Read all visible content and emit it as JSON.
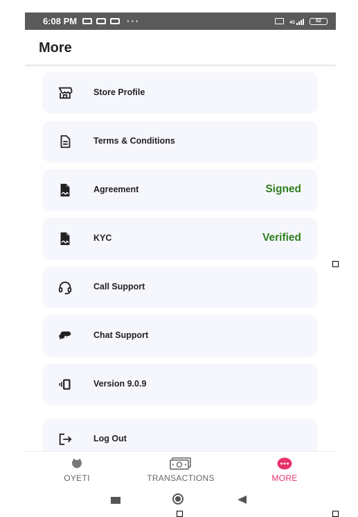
{
  "status_bar": {
    "time": "6:08 PM",
    "dots": "···",
    "volte": "4G",
    "battery": "62"
  },
  "header": {
    "title": "More"
  },
  "menu": {
    "items": [
      {
        "label": "Store Profile",
        "icon": "store-icon"
      },
      {
        "label": "Terms & Conditions",
        "icon": "document-icon"
      },
      {
        "label": "Agreement",
        "icon": "signature-file-icon",
        "status": "Signed"
      },
      {
        "label": "KYC",
        "icon": "signature-file-icon",
        "status": "Verified"
      },
      {
        "label": "Call Support",
        "icon": "headset-icon"
      },
      {
        "label": "Chat Support",
        "icon": "chat-bubbles-icon"
      },
      {
        "label": "Version 9.0.9",
        "icon": "phone-vibrate-icon"
      },
      {
        "label": "Log Out",
        "icon": "logout-icon"
      }
    ],
    "status_color": "#2e7d1f"
  },
  "bottom_nav": {
    "tabs": [
      {
        "label": "OYETI",
        "icon": "oyeti-logo-icon",
        "active": false
      },
      {
        "label": "TRANSACTIONS",
        "icon": "cash-icon",
        "active": false
      },
      {
        "label": "MORE",
        "icon": "more-dots-icon",
        "active": true
      }
    ],
    "active_color": "#e8336a",
    "inactive_color": "#666666"
  }
}
